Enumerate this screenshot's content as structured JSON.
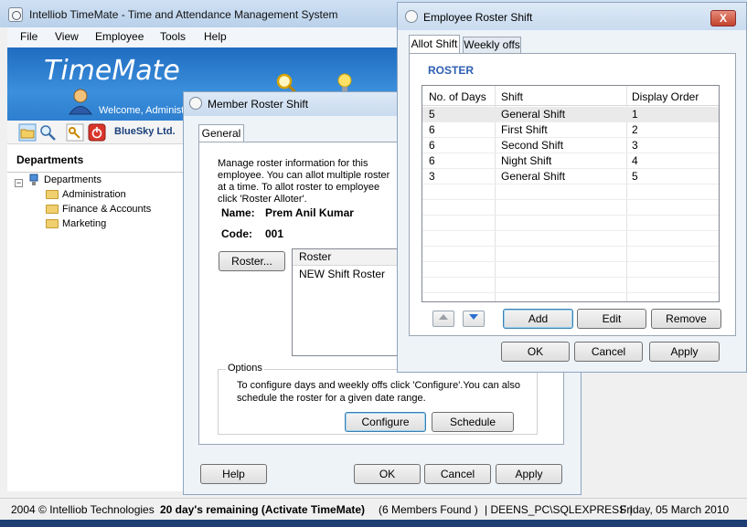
{
  "main": {
    "title": "Intelliob TimeMate - Time and Attendance Management System",
    "menu": [
      "File",
      "View",
      "Employee",
      "Tools",
      "Help"
    ],
    "logo": "TimeMate",
    "welcome": "Welcome, Administ",
    "company": "BlueSky Ltd.",
    "departments_header": "Departments",
    "tree": {
      "root": "Departments",
      "items": [
        "Administration",
        "Finance & Accounts",
        "Marketing"
      ]
    },
    "status": {
      "copyright": "2004 © Intelliob Technologies",
      "trial": "20 day's remaining (Activate TimeMate)",
      "members": "(6 Members Found )",
      "server": "| DEENS_PC\\SQLEXPRESS |",
      "date": "Friday, 05 March 2010"
    }
  },
  "member_dialog": {
    "title": "Member Roster Shift",
    "tab": "General",
    "description": "Manage roster information for this employee. You can allot multiple roster at a time. To allot roster to employee click 'Roster Alloter'.",
    "name_label": "Name:",
    "name_value": "Prem Anil Kumar",
    "code_label": "Code:",
    "code_value": "001",
    "roster_button": "Roster...",
    "roster_list": {
      "header": "Roster",
      "items": [
        "NEW Shift Roster"
      ]
    },
    "options": {
      "legend": "Options",
      "text": "To configure days and weekly offs click 'Configure'.You can also schedule the roster for a given date range.",
      "configure": "Configure",
      "schedule": "Schedule"
    },
    "buttons": {
      "help": "Help",
      "ok": "OK",
      "cancel": "Cancel",
      "apply": "Apply"
    }
  },
  "employee_dialog": {
    "title": "Employee Roster Shift",
    "close": "X",
    "tabs": [
      "Allot Shift",
      "Weekly offs"
    ],
    "section": "ROSTER",
    "columns": [
      "No. of Days",
      "Shift",
      "Display Order"
    ],
    "rows": [
      {
        "days": "5",
        "shift": "General Shift",
        "order": "1"
      },
      {
        "days": "6",
        "shift": "First Shift",
        "order": "2"
      },
      {
        "days": "6",
        "shift": "Second Shift",
        "order": "3"
      },
      {
        "days": "6",
        "shift": "Night Shift",
        "order": "4"
      },
      {
        "days": "3",
        "shift": "General Shift",
        "order": "5"
      }
    ],
    "buttons": {
      "add": "Add",
      "edit": "Edit",
      "remove": "Remove",
      "ok": "OK",
      "cancel": "Cancel",
      "apply": "Apply"
    }
  },
  "colors": {
    "banner": "#2e7fcf",
    "accent": "#2f5fb3",
    "close": "#c3432d"
  }
}
